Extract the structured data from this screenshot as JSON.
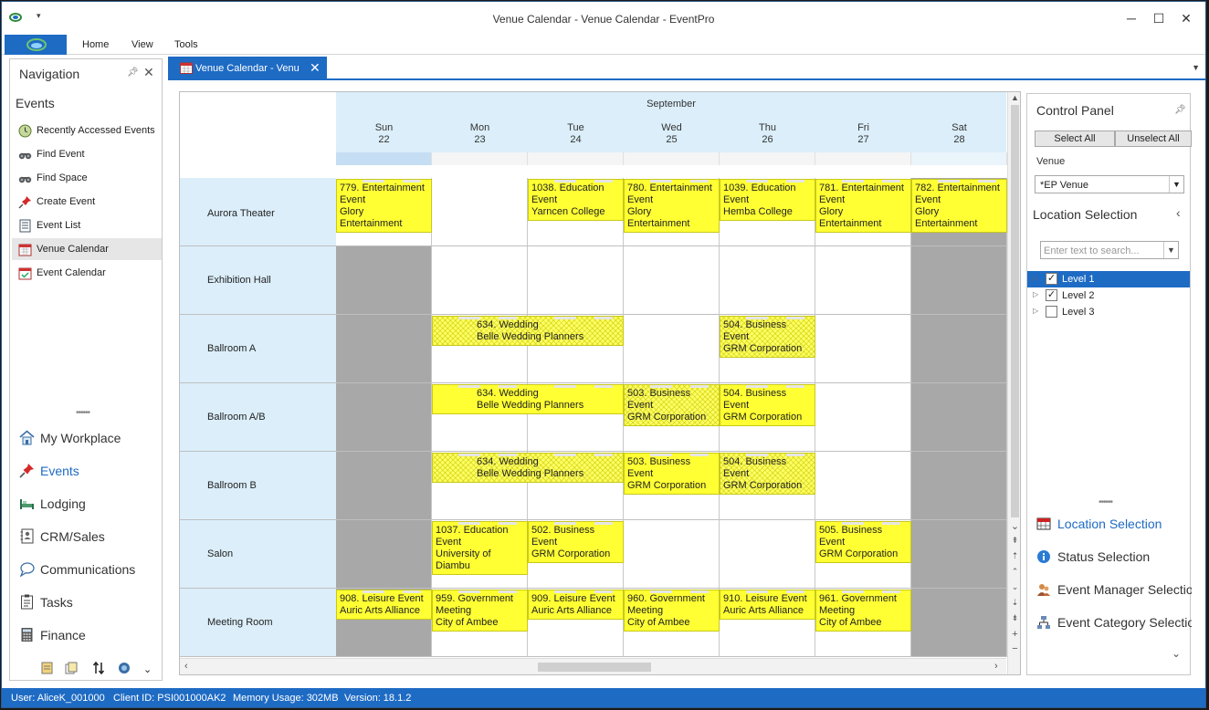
{
  "window": {
    "title": "Venue Calendar - Venue Calendar - EventPro"
  },
  "ribbon": {
    "menus": [
      "Home",
      "View",
      "Tools"
    ]
  },
  "nav": {
    "header": "Navigation",
    "section": "Events",
    "items": [
      {
        "label": "Recently Accessed Events",
        "icon": "recent-events-icon"
      },
      {
        "label": "Find Event",
        "icon": "binoculars-icon"
      },
      {
        "label": "Find Space",
        "icon": "binoculars-icon"
      },
      {
        "label": "Create Event",
        "icon": "pushpin-icon"
      },
      {
        "label": "Event List",
        "icon": "list-icon"
      },
      {
        "label": "Venue Calendar",
        "icon": "calendar-icon"
      },
      {
        "label": "Event Calendar",
        "icon": "calendar-check-icon"
      }
    ],
    "groups": [
      {
        "label": "My Workplace",
        "icon": "house-icon"
      },
      {
        "label": "Events",
        "icon": "pushpin-icon"
      },
      {
        "label": "Lodging",
        "icon": "bed-icon"
      },
      {
        "label": "CRM/Sales",
        "icon": "address-book-icon"
      },
      {
        "label": "Communications",
        "icon": "speech-bubble-icon"
      },
      {
        "label": "Tasks",
        "icon": "clipboard-icon"
      },
      {
        "label": "Finance",
        "icon": "calculator-icon"
      }
    ]
  },
  "doc_tab": {
    "label": "Venue Calendar - Venue Calendar"
  },
  "calendar": {
    "month": "September",
    "days": [
      {
        "dow": "Sun",
        "date": "22"
      },
      {
        "dow": "Mon",
        "date": "23"
      },
      {
        "dow": "Tue",
        "date": "24"
      },
      {
        "dow": "Wed",
        "date": "25"
      },
      {
        "dow": "Thu",
        "date": "26"
      },
      {
        "dow": "Fri",
        "date": "27"
      },
      {
        "dow": "Sat",
        "date": "28"
      }
    ],
    "rooms": [
      "Aurora Theater",
      "Exhibition Hall",
      "Ballroom A",
      "Ballroom A/B",
      "Ballroom B",
      "Salon",
      "Meeting Room"
    ],
    "events": [
      {
        "room": 0,
        "start": 0,
        "span": 1,
        "text": "779. Entertainment\nEvent\nGlory\nEntertainment",
        "style": "solid"
      },
      {
        "room": 0,
        "start": 2,
        "span": 1,
        "text": "1038. Education\nEvent\nYarncen College",
        "style": "solid"
      },
      {
        "room": 0,
        "start": 3,
        "span": 1,
        "text": "780. Entertainment\nEvent\nGlory\nEntertainment",
        "style": "solid"
      },
      {
        "room": 0,
        "start": 4,
        "span": 1,
        "text": "1039. Education\nEvent\nHemba College",
        "style": "solid"
      },
      {
        "room": 0,
        "start": 5,
        "span": 1,
        "text": "781. Entertainment\nEvent\nGlory\nEntertainment",
        "style": "solid"
      },
      {
        "room": 0,
        "start": 6,
        "span": 1,
        "text": "782. Entertainment\nEvent\nGlory\nEntertainment",
        "style": "solid"
      },
      {
        "room": 2,
        "start": 1,
        "span": 2,
        "text": "634. Wedding\nBelle Wedding Planners",
        "style": "hatch"
      },
      {
        "room": 2,
        "start": 4,
        "span": 1,
        "text": "504. Business\nEvent\nGRM Corporation",
        "style": "hatch"
      },
      {
        "room": 3,
        "start": 1,
        "span": 2,
        "text": "634. Wedding\nBelle Wedding Planners",
        "style": "solid"
      },
      {
        "room": 3,
        "start": 3,
        "span": 1,
        "text": "503. Business\nEvent\nGRM Corporation",
        "style": "hatch"
      },
      {
        "room": 3,
        "start": 4,
        "span": 1,
        "text": "504. Business\nEvent\nGRM Corporation",
        "style": "solid"
      },
      {
        "room": 4,
        "start": 1,
        "span": 2,
        "text": "634. Wedding\nBelle Wedding Planners",
        "style": "hatch"
      },
      {
        "room": 4,
        "start": 3,
        "span": 1,
        "text": "503. Business\nEvent\nGRM Corporation",
        "style": "solid"
      },
      {
        "room": 4,
        "start": 4,
        "span": 1,
        "text": "504. Business\nEvent\nGRM Corporation",
        "style": "hatch"
      },
      {
        "room": 5,
        "start": 1,
        "span": 1,
        "text": "1037. Education\nEvent\nUniversity of\nDiambu",
        "style": "solid"
      },
      {
        "room": 5,
        "start": 2,
        "span": 1,
        "text": "502. Business\nEvent\nGRM Corporation",
        "style": "solid"
      },
      {
        "room": 5,
        "start": 5,
        "span": 1,
        "text": "505. Business\nEvent\nGRM Corporation",
        "style": "solid"
      },
      {
        "room": 6,
        "start": 0,
        "span": 1,
        "text": "908. Leisure Event\nAuric Arts Alliance",
        "style": "solid"
      },
      {
        "room": 6,
        "start": 1,
        "span": 1,
        "text": "959. Government\nMeeting\nCity of Ambee",
        "style": "solid"
      },
      {
        "room": 6,
        "start": 2,
        "span": 1,
        "text": "909. Leisure Event\nAuric Arts Alliance",
        "style": "solid"
      },
      {
        "room": 6,
        "start": 3,
        "span": 1,
        "text": "960. Government\nMeeting\nCity of Ambee",
        "style": "solid"
      },
      {
        "room": 6,
        "start": 4,
        "span": 1,
        "text": "910. Leisure Event\nAuric Arts Alliance",
        "style": "solid"
      },
      {
        "room": 6,
        "start": 5,
        "span": 1,
        "text": "961. Government\nMeeting\nCity of Ambee",
        "style": "solid"
      }
    ],
    "unavailable": [
      [
        1,
        0
      ],
      [
        1,
        6
      ],
      [
        2,
        0
      ],
      [
        2,
        6
      ],
      [
        3,
        0
      ],
      [
        3,
        6
      ],
      [
        4,
        0
      ],
      [
        4,
        6
      ],
      [
        5,
        0
      ],
      [
        5,
        6
      ],
      [
        6,
        0
      ],
      [
        6,
        6
      ],
      [
        0,
        6
      ]
    ]
  },
  "control_panel": {
    "title": "Control Panel",
    "select_all": "Select All",
    "unselect_all": "Unselect All",
    "venue_label": "Venue",
    "venue_value": "*EP Venue",
    "location_title": "Location Selection",
    "search_placeholder": "Enter text to search...",
    "levels": [
      {
        "label": "Level 1",
        "checked": true,
        "selected": true
      },
      {
        "label": "Level 2",
        "checked": true,
        "selected": false
      },
      {
        "label": "Level 3",
        "checked": false,
        "selected": false
      }
    ],
    "links": [
      {
        "label": "Location Selection",
        "icon": "location-grid-icon"
      },
      {
        "label": "Status Selection",
        "icon": "info-icon"
      },
      {
        "label": "Event Manager Selection",
        "icon": "people-icon"
      },
      {
        "label": "Event Category Selection",
        "icon": "hierarchy-icon"
      }
    ]
  },
  "status": {
    "user": "User: AliceK_001000",
    "client": "Client ID: PSI001000AK2",
    "memory": "Memory Usage: 302MB",
    "version": "Version: 18.1.2"
  },
  "colors": {
    "accent": "#1e6bc4",
    "event": "#ffff33",
    "header": "#dbeefa",
    "unavailable": "#a8a8a8"
  }
}
